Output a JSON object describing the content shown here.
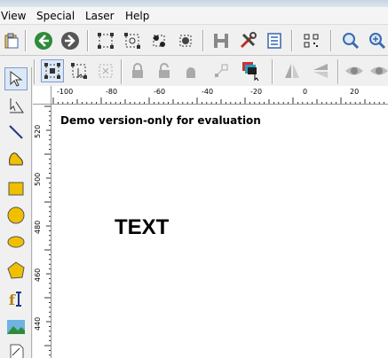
{
  "menu": {
    "items": [
      "View",
      "Special",
      "Laser",
      "Help"
    ]
  },
  "toolbar1": {
    "icons": [
      "clipboard-icon",
      "back-arrow-icon",
      "forward-arrow-icon",
      "group-icon",
      "ungroup-icon",
      "group-dots-icon",
      "ungroup-dots-icon",
      "hatch-icon",
      "tools-icon",
      "list-icon",
      "barcode-icon",
      "zoom-in-icon",
      "zoom-icon"
    ]
  },
  "toolbar2": {
    "icons": [
      "select-group-icon",
      "select-node-icon",
      "select-disabled-icon",
      "lock-icon",
      "lock-open-icon",
      "lock-solid-icon",
      "align-icon",
      "color-layers-icon",
      "mirror-horizontal-icon",
      "mirror-vertical-icon",
      "eye-icon",
      "eye-off-icon"
    ]
  },
  "left_tools": [
    "pointer-icon",
    "node-edit-icon",
    "line-icon",
    "curve-icon",
    "rectangle-icon",
    "circle-icon",
    "ellipse-icon",
    "polygon-icon",
    "text-tool-icon",
    "image-icon",
    "vector-file-icon"
  ],
  "ruler": {
    "horizontal_labels": [
      "-100",
      "-80",
      "-60",
      "-40",
      "-20",
      "0",
      "20"
    ],
    "vertical_labels": [
      "520",
      "500",
      "480",
      "460",
      "440"
    ]
  },
  "canvas": {
    "demo_notice": "Demo version-only for evaluation",
    "text_object": "TEXT"
  },
  "colors": {
    "background": "#f0f0f0",
    "canvas": "#ffffff",
    "accent_green": "#2e8b3a"
  }
}
